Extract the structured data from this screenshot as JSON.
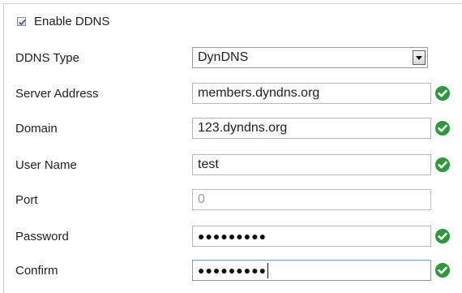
{
  "enable": {
    "label": "Enable DDNS",
    "checked": true
  },
  "ddns_type": {
    "label": "DDNS Type",
    "value": "DynDNS"
  },
  "server_address": {
    "label": "Server Address",
    "value": "members.dyndns.org",
    "valid": true
  },
  "domain": {
    "label": "Domain",
    "value": "123.dyndns.org",
    "valid": true
  },
  "user_name": {
    "label": "User Name",
    "value": "test",
    "valid": true
  },
  "port": {
    "label": "Port",
    "value": "0",
    "disabled": true
  },
  "password": {
    "label": "Password",
    "masked": "●●●●●●●●●",
    "valid": true
  },
  "confirm": {
    "label": "Confirm",
    "masked": "●●●●●●●●●",
    "valid": true
  },
  "icons": {
    "valid": "check-circle-icon",
    "dropdown": "chevron-down-icon",
    "checkbox": "checkmark-icon"
  },
  "colors": {
    "valid_green": "#2c9a3a",
    "focus_border": "#6f9fd2"
  }
}
